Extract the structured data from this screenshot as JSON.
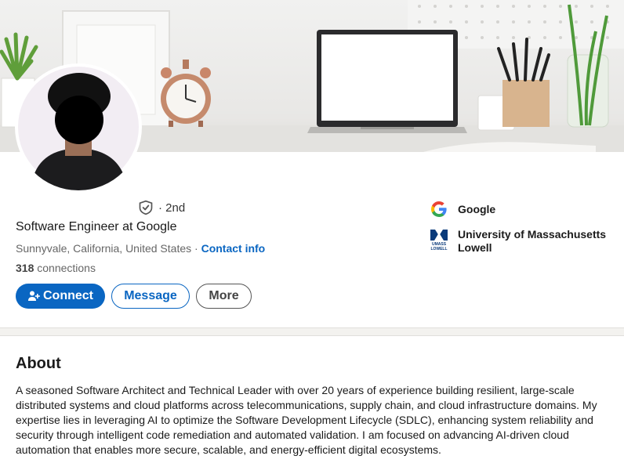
{
  "profile": {
    "degree": "· 2nd",
    "headline": "Software Engineer at Google",
    "location": "Sunnyvale, California, United States",
    "location_separator": " · ",
    "contact_info": "Contact info",
    "connections_count": "318",
    "connections_label": "connections"
  },
  "actions": {
    "connect": "Connect",
    "message": "Message",
    "more": "More"
  },
  "organizations": [
    {
      "name": "Google",
      "icon": "google-logo"
    },
    {
      "name": "University of Massachusetts Lowell",
      "icon": "umass-lowell-logo"
    }
  ],
  "umass_logo_text": {
    "line1": "UMASS",
    "line2": "LOWELL"
  },
  "about": {
    "title": "About",
    "text": "A seasoned Software Architect and Technical Leader with over 20 years of experience building resilient, large-scale distributed systems and cloud platforms across telecommunications, supply chain, and cloud infrastructure domains. My expertise lies in leveraging AI to optimize the Software Development Lifecycle (SDLC), enhancing system reliability and security through intelligent code remediation and automated validation. I am focused on advancing AI-driven cloud automation that enables more secure, scalable, and energy-efficient digital ecosystems."
  },
  "colors": {
    "accent": "#0a66c2",
    "background": "#f3f2ef"
  }
}
